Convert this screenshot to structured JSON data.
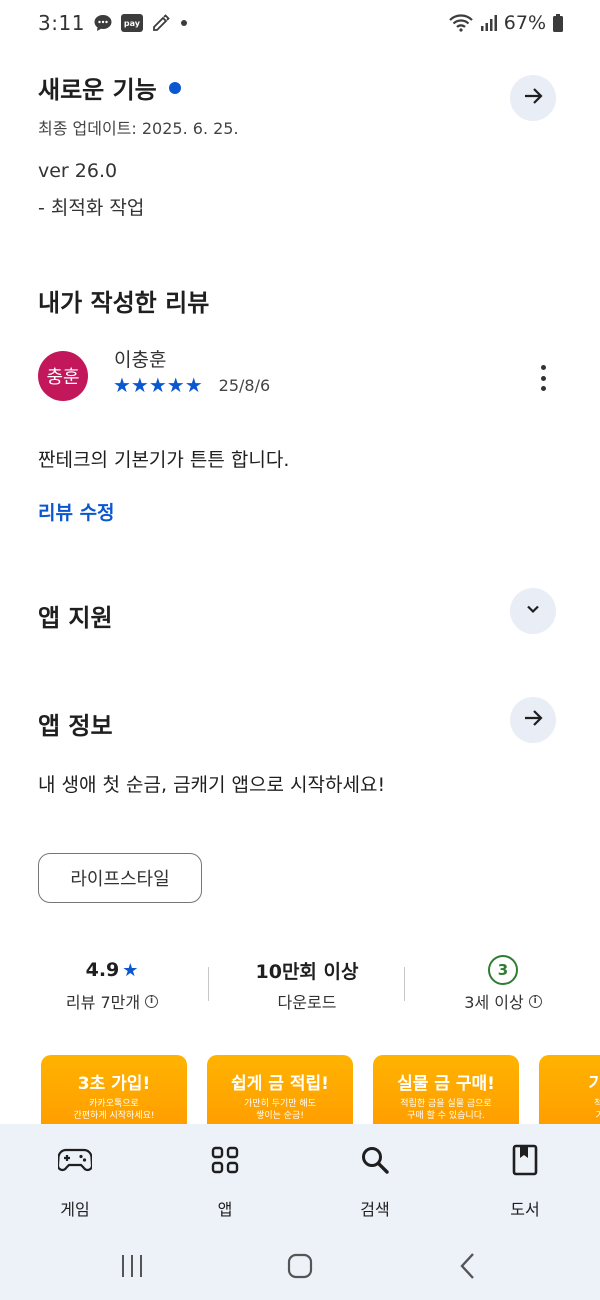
{
  "status_bar": {
    "time": "3:11",
    "pay_badge": "pay",
    "battery": "67%"
  },
  "whats_new": {
    "title": "새로운 기능",
    "updated": "최종 업데이트: 2025. 6. 25.",
    "version": "ver 26.0",
    "note": "- 최적화 작업"
  },
  "my_review": {
    "title": "내가 작성한 리뷰",
    "avatar_text": "충훈",
    "reviewer": "이충훈",
    "rating": 5,
    "stars": "★★★★★",
    "date": "25/8/6",
    "text": "짠테크의 기본기가 튼튼 합니다.",
    "edit_label": "리뷰 수정"
  },
  "app_support": {
    "title": "앱 지원"
  },
  "app_info": {
    "title": "앱 정보",
    "description": "내 생애 첫 순금, 금캐기 앱으로 시작하세요!",
    "category_chip": "라이프스타일"
  },
  "stats": {
    "rating_value": "4.9",
    "rating_star": "★",
    "rating_label": "리뷰 7만개",
    "downloads_value": "10만회 이상",
    "downloads_label": "다운로드",
    "age_badge": "3",
    "age_label": "3세 이상",
    "info_glyph": "i"
  },
  "screenshots": [
    {
      "title": "3초 가입!",
      "subtitle": "카카오톡으로\n간편하게 시작하세요!"
    },
    {
      "title": "쉽게 금 적립!",
      "subtitle": "가만히 두기만 해도\n쌓이는 순금!"
    },
    {
      "title": "실물 금 구매!",
      "subtitle": "적립한 금을 실물 금으로\n구매 할 수 있습니다."
    },
    {
      "title": "기프티",
      "subtitle": "적립한 금\n기프티콘"
    }
  ],
  "bottom_nav": {
    "items": [
      {
        "label": "게임",
        "icon": "gamepad-icon"
      },
      {
        "label": "앱",
        "icon": "apps-grid-icon"
      },
      {
        "label": "검색",
        "icon": "search-icon"
      },
      {
        "label": "도서",
        "icon": "book-icon"
      }
    ]
  },
  "colors": {
    "accent_blue": "#0b57d0",
    "avatar_bg": "#c2185b",
    "age_green": "#2e7d32",
    "screenshot_orange": "#ff9800",
    "nav_bg": "#edf1f8"
  }
}
